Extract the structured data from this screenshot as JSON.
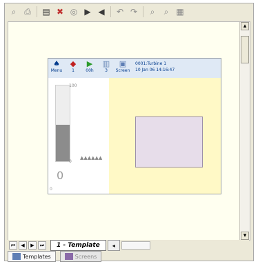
{
  "toolbar": {
    "icons": [
      {
        "name": "open-icon",
        "glyph": "⌕"
      },
      {
        "name": "print-icon",
        "glyph": "⎙"
      },
      {
        "name": "new-template-icon",
        "glyph": "▤"
      },
      {
        "name": "delete-icon",
        "glyph": "✖"
      },
      {
        "name": "layers-icon",
        "glyph": "◎"
      },
      {
        "name": "send-forward-icon",
        "glyph": "▶"
      },
      {
        "name": "send-back-icon",
        "glyph": "◀"
      },
      {
        "name": "undo-icon",
        "glyph": "↶"
      },
      {
        "name": "redo-icon",
        "glyph": "↷"
      },
      {
        "name": "zoom-in-icon",
        "glyph": "⌕"
      },
      {
        "name": "zoom-out-icon",
        "glyph": "⌕"
      },
      {
        "name": "grid-icon",
        "glyph": "▦"
      }
    ]
  },
  "panel": {
    "buttons": [
      {
        "name": "menu-button",
        "icon": "menu-icon",
        "glyph": "♠",
        "label": "Menu"
      },
      {
        "name": "alarms-button",
        "icon": "bell-icon",
        "glyph": "◆",
        "label": "1"
      },
      {
        "name": "run-button",
        "icon": "play-icon",
        "glyph": "▶",
        "label": "00h"
      },
      {
        "name": "events-button",
        "icon": "list-icon",
        "glyph": "▥",
        "label": "3"
      },
      {
        "name": "screen-button",
        "icon": "screen-icon",
        "glyph": "▣",
        "label": "Screen"
      }
    ],
    "device": "0001:Turbine 1",
    "datetime": "10 Jan 06  14:16:47",
    "scale_top": "100",
    "scale_bottom": "0",
    "value": "0",
    "mini_zero": "0",
    "triangles": "▲▲▲▲▲▲"
  },
  "level_fraction": 0.48,
  "tabs": {
    "template_label": "1 - Template"
  },
  "bottom_tabs": [
    {
      "label": "Templates"
    },
    {
      "label": "Screens"
    }
  ]
}
